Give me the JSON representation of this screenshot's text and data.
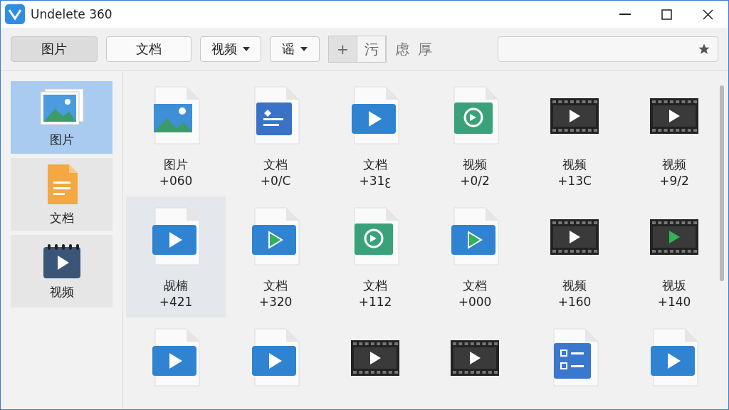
{
  "window": {
    "title": "Undelete 360"
  },
  "toolbar": {
    "buttons": [
      {
        "label": "图片",
        "selected": true,
        "dropdown": false
      },
      {
        "label": "文档",
        "selected": false,
        "dropdown": false
      },
      {
        "label": "视频",
        "selected": false,
        "dropdown": true
      },
      {
        "label": "谣",
        "selected": false,
        "dropdown": true
      }
    ],
    "segments": [
      {
        "label": "+",
        "selected": true
      },
      {
        "label": "污",
        "selected": false
      }
    ],
    "extra": [
      "虑",
      "厚"
    ]
  },
  "sidebar": {
    "items": [
      {
        "label": "图片",
        "kind": "image",
        "selected": true
      },
      {
        "label": "文档",
        "kind": "doc",
        "selected": false
      },
      {
        "label": "视频",
        "kind": "video",
        "selected": false
      }
    ]
  },
  "files": [
    {
      "name": "图片",
      "count": "+060",
      "kind": "image",
      "selected": false
    },
    {
      "name": "文档",
      "count": "+0/C",
      "kind": "doc",
      "selected": false
    },
    {
      "name": "文档",
      "count": "+31ꜫ",
      "kind": "video",
      "selected": false
    },
    {
      "name": "视频",
      "count": "+0/2",
      "kind": "chat",
      "selected": false
    },
    {
      "name": "视频",
      "count": "+13C",
      "kind": "film",
      "selected": false
    },
    {
      "name": "视频",
      "count": "+9/2",
      "kind": "film",
      "selected": false
    },
    {
      "name": "觇楠",
      "count": "+421",
      "kind": "video",
      "selected": true
    },
    {
      "name": "文档",
      "count": "+320",
      "kind": "video-alt",
      "selected": false
    },
    {
      "name": "文档",
      "count": "+112",
      "kind": "chat",
      "selected": false
    },
    {
      "name": "文档",
      "count": "+000",
      "kind": "video-alt",
      "selected": false
    },
    {
      "name": "视频",
      "count": "+160",
      "kind": "film",
      "selected": false
    },
    {
      "name": "视坂",
      "count": "+140",
      "kind": "film-alt",
      "selected": false
    },
    {
      "kind": "video",
      "selected": false
    },
    {
      "kind": "video",
      "selected": false
    },
    {
      "kind": "film",
      "selected": false
    },
    {
      "kind": "film",
      "selected": false
    },
    {
      "kind": "list",
      "selected": false
    },
    {
      "kind": "video",
      "selected": false
    }
  ]
}
